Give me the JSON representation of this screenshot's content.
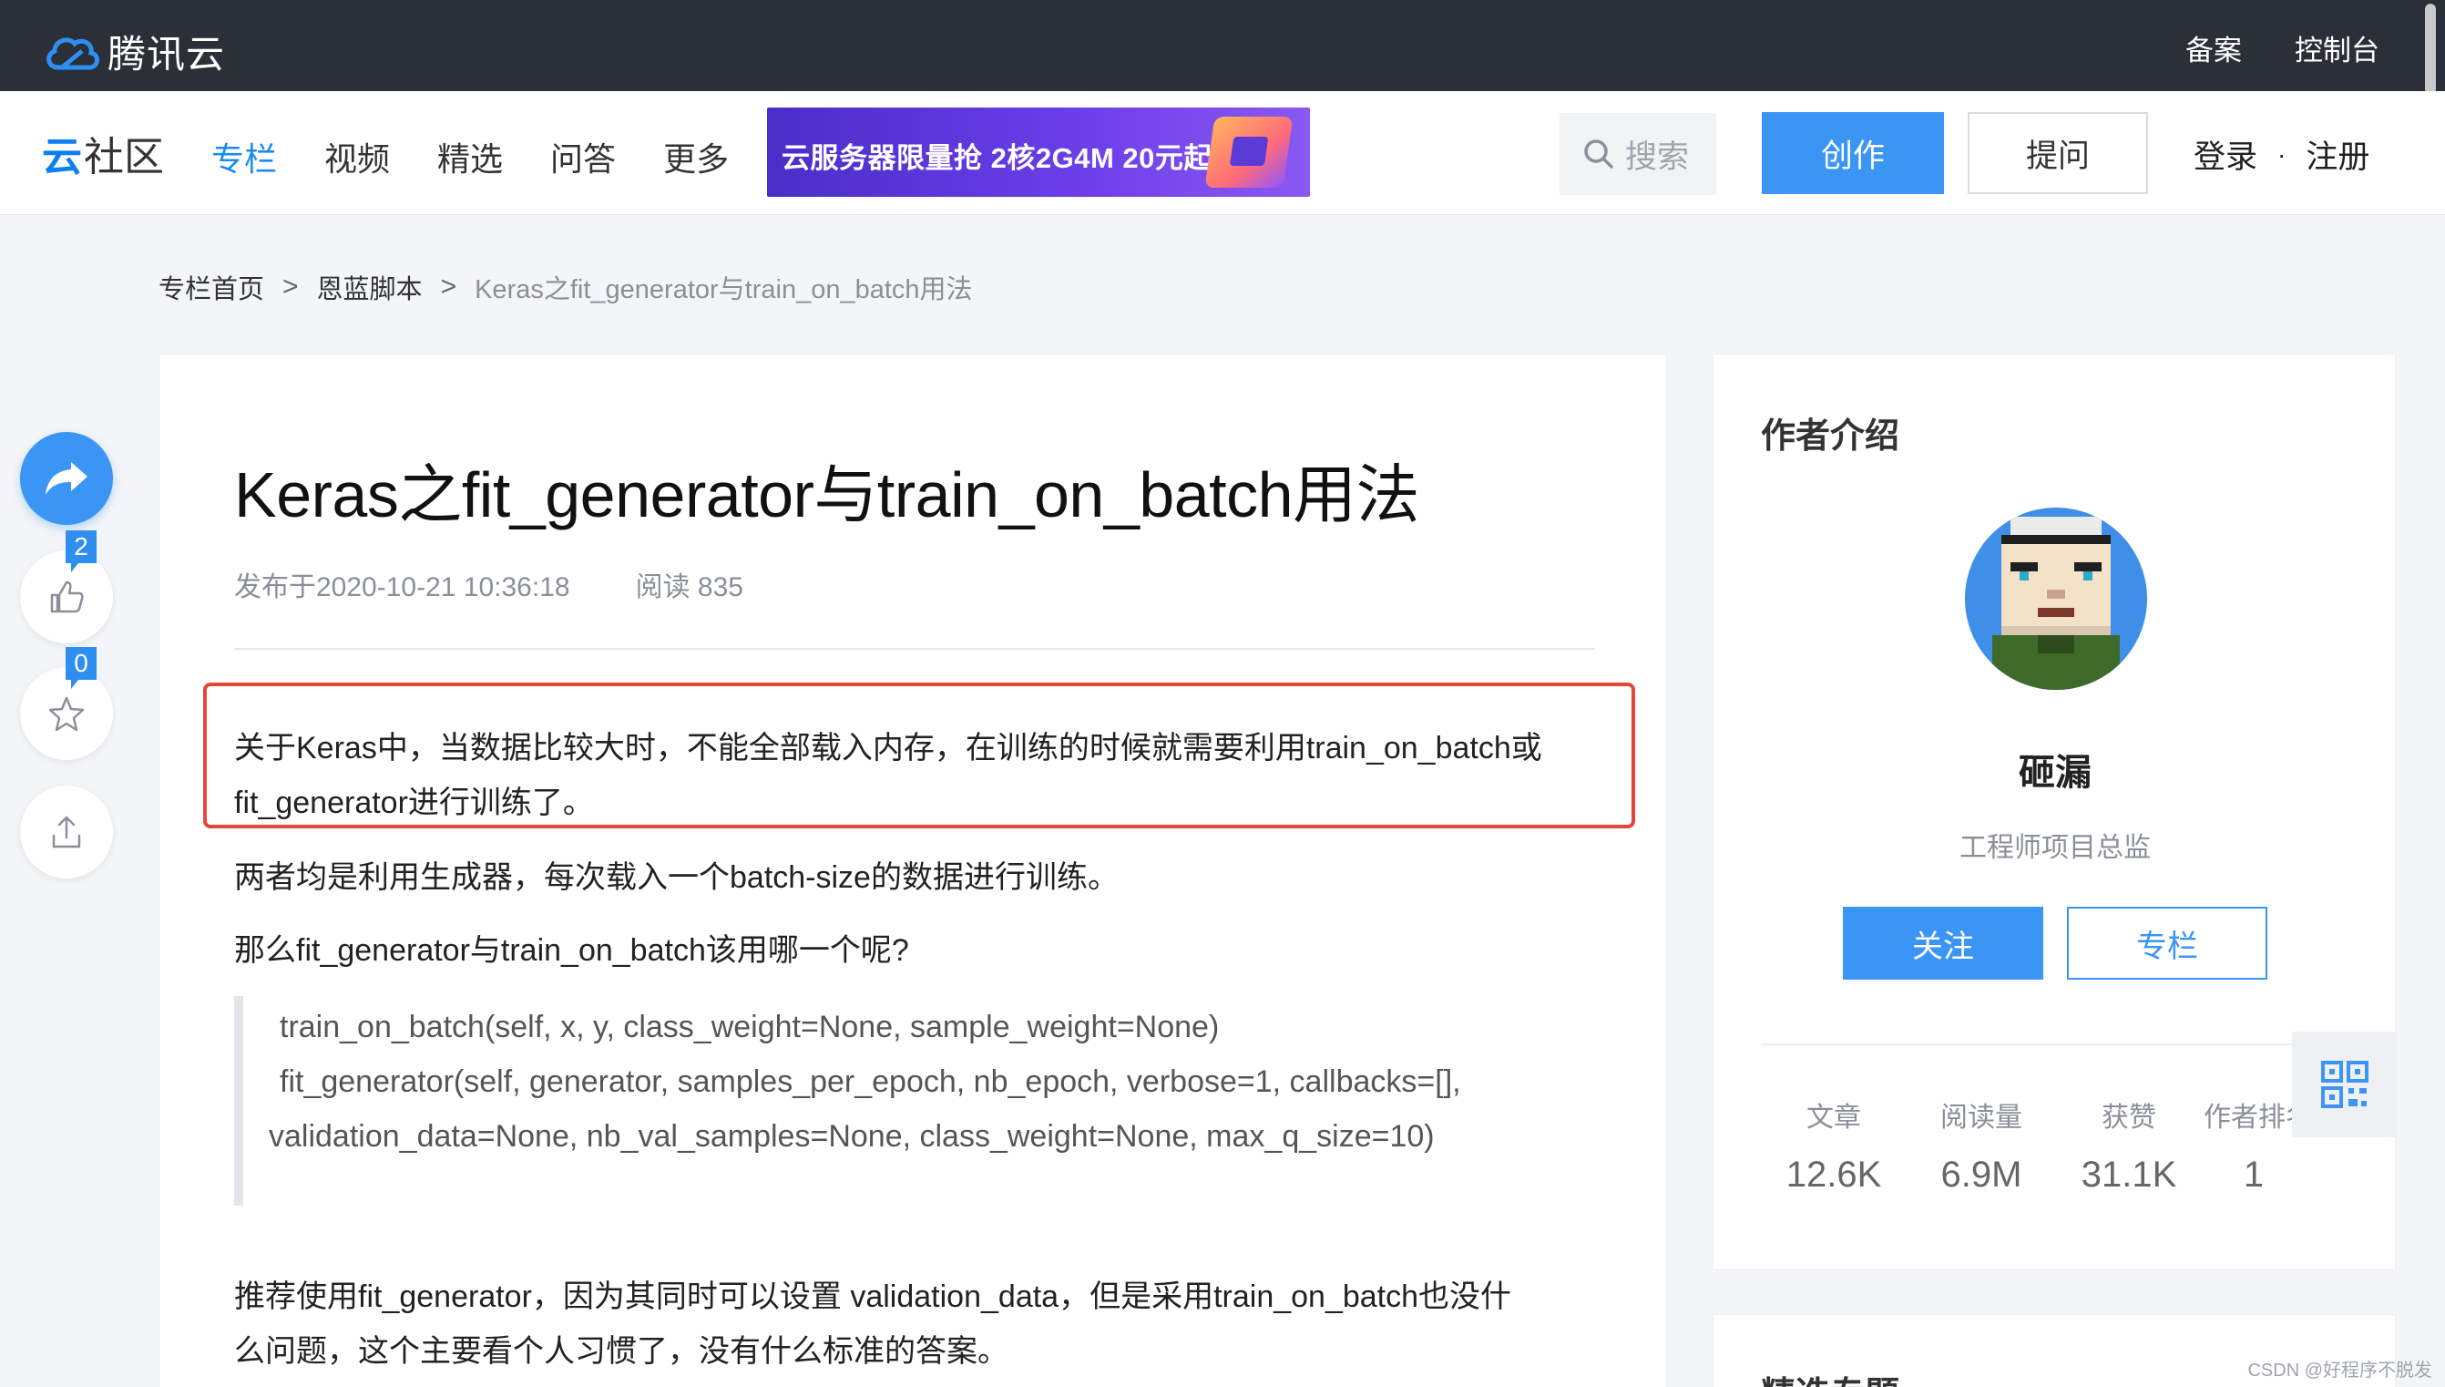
{
  "topbar": {
    "brand": "腾讯云",
    "links": [
      "备案",
      "控制台"
    ]
  },
  "nav": {
    "logo_text": "社区",
    "logo_glyph": "云",
    "links": [
      "专栏",
      "视频",
      "精选",
      "问答",
      "更多"
    ],
    "active_link": "专栏",
    "promo": "云服务器限量抢  2核2G4M 20元起",
    "search_label": "搜索",
    "create_button": "创作",
    "ask_button": "提问",
    "login": "登录",
    "dot": "·",
    "register": "注册"
  },
  "breadcrumb": {
    "items": [
      "专栏首页",
      "恩蓝脚本",
      "Keras之fit_generator与train_on_batch用法"
    ],
    "separator": ">"
  },
  "actions": {
    "like_count": "2",
    "favorite_count": "0"
  },
  "article": {
    "title": "Keras之fit_generator与train_on_batch用法",
    "published": "发布于2020-10-21 10:36:18",
    "reads": "阅读 835",
    "p1_line1": "关于Keras中，当数据比较大时，不能全部载入内存，在训练的时候就需要利用train_on_batch或",
    "p1_line2": "fit_generator进行训练了。",
    "p2": "两者均是利用生成器，每次载入一个batch-size的数据进行训练。",
    "p3": "那么fit_generator与train_on_batch该用哪一个呢?",
    "code_line1": "train_on_batch(self, x, y, class_weight=None, sample_weight=None)",
    "code_line2": "fit_generator(self, generator, samples_per_epoch, nb_epoch, verbose=1, callbacks=[],",
    "code_line3": "validation_data=None, nb_val_samples=None, class_weight=None, max_q_size=10)",
    "p4_line1": "推荐使用fit_generator，因为其同时可以设置 validation_data，但是采用train_on_batch也没什",
    "p4_line2": "么问题，这个主要看个人习惯了，没有什么标准的答案。"
  },
  "author": {
    "heading": "作者介绍",
    "name": "砸漏",
    "title": "工程师项目总监",
    "follow_button": "关注",
    "column_button": "专栏",
    "stats": [
      {
        "label": "文章",
        "value": "12.6K"
      },
      {
        "label": "阅读量",
        "value": "6.9M"
      },
      {
        "label": "获赞",
        "value": "31.1K"
      },
      {
        "label": "作者排名",
        "value": "1"
      }
    ]
  },
  "second_card": {
    "title": "精选专题"
  },
  "watermark": "CSDN @好程序不脱发",
  "colors": {
    "topbar": "#2b2f37",
    "accent": "#3b95f4",
    "highlight_border": "#e64539"
  }
}
